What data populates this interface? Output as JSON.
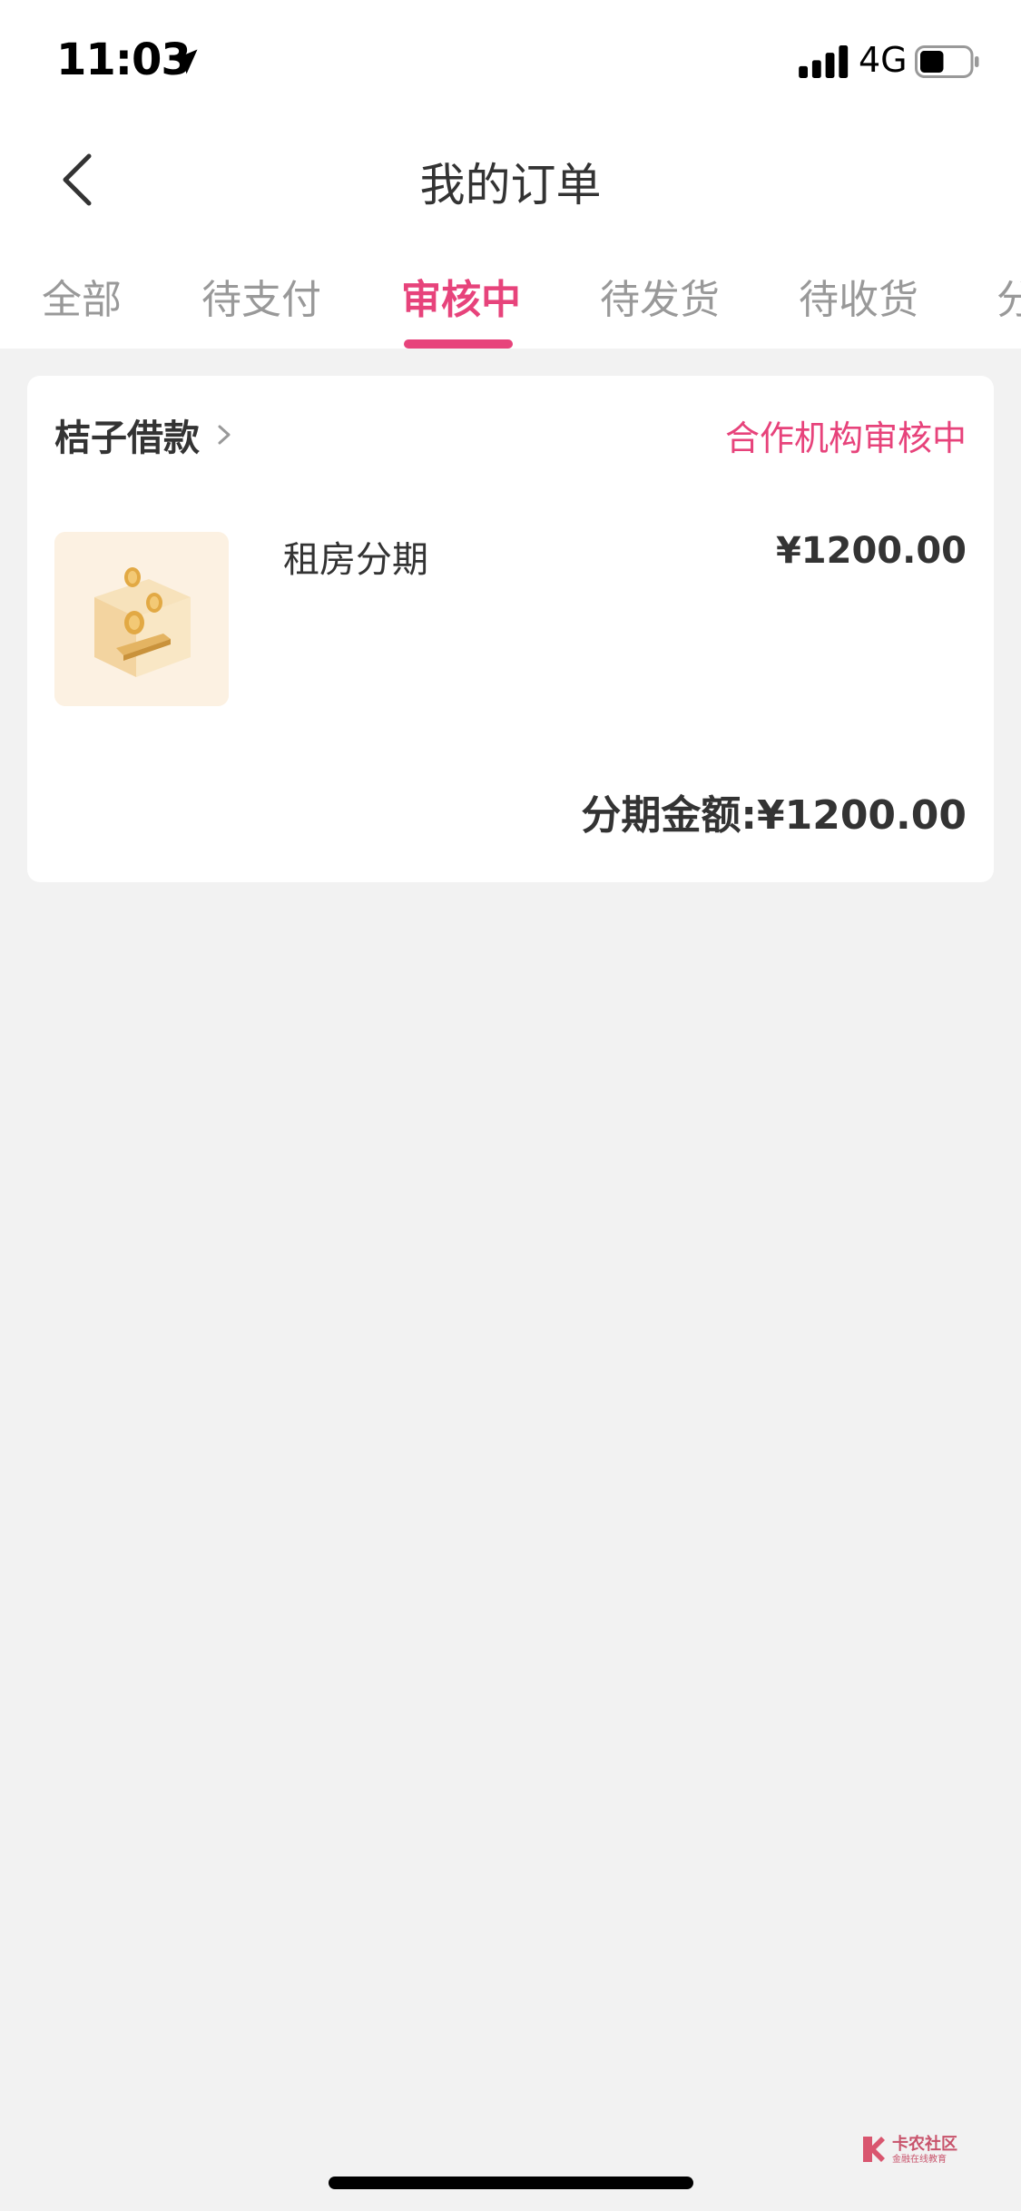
{
  "status_bar": {
    "time": "11:03",
    "network": "4G",
    "battery_percent": 45
  },
  "header": {
    "title": "我的订单"
  },
  "tabs": [
    {
      "label": "全部",
      "active": false
    },
    {
      "label": "待支付",
      "active": false
    },
    {
      "label": "审核中",
      "active": true
    },
    {
      "label": "待发货",
      "active": false
    },
    {
      "label": "待收货",
      "active": false
    },
    {
      "label": "分",
      "active": false
    }
  ],
  "order": {
    "merchant": "桔子借款",
    "status": "合作机构审核中",
    "product_name": "租房分期",
    "price": "¥1200.00",
    "installment_total": "分期金额:¥1200.00"
  },
  "watermark": {
    "title": "卡农社区",
    "subtitle": "金融在线教育"
  },
  "colors": {
    "accent": "#e7437b",
    "background": "#f2f2f2",
    "card": "#ffffff",
    "tab_inactive": "#999999"
  }
}
